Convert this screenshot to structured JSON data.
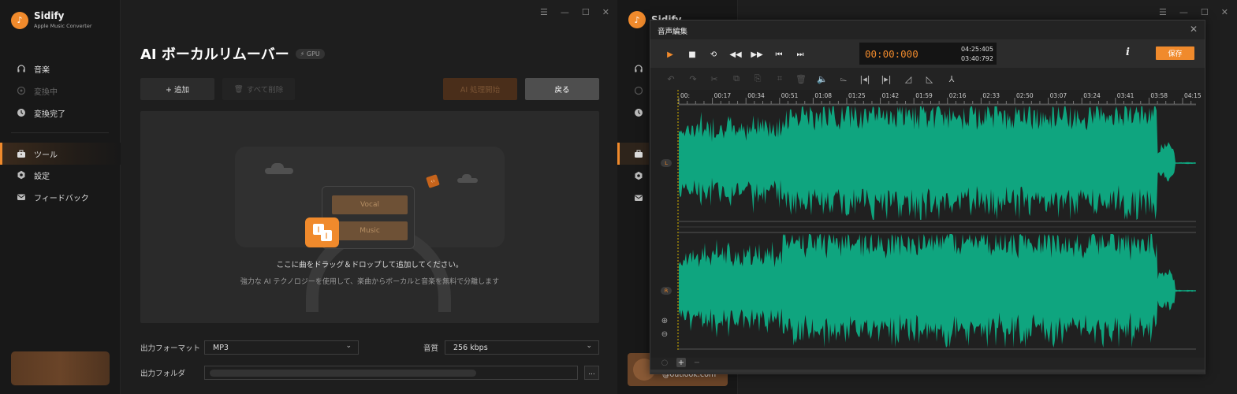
{
  "brand": {
    "name": "Sidify",
    "subtitle": "Apple Music Converter"
  },
  "window_controls": [
    "☰",
    "—",
    "☐",
    "✕"
  ],
  "sidebar": {
    "items": [
      {
        "label": "音楽",
        "icon": "headphones-icon"
      },
      {
        "label": "変換中",
        "icon": "converting-icon"
      },
      {
        "label": "変換完了",
        "icon": "clock-icon"
      },
      {
        "label": "ツール",
        "icon": "toolbox-icon"
      },
      {
        "label": "設定",
        "icon": "gear-icon"
      },
      {
        "label": "フィードバック",
        "icon": "mail-icon"
      }
    ]
  },
  "main": {
    "title": "AI ボーカルリムーバー",
    "gpu_badge": "GPU",
    "add_label": "+ 追加",
    "clear_label": "すべて削除",
    "ai_start_label": "AI 処理開始",
    "back_label": "戻る",
    "drop_pill_vocal": "Vocal",
    "drop_pill_music": "Music",
    "drop_text": "ここに曲をドラッグ＆ドロップして追加してください。",
    "drop_subtext": "強力な AI テクノロジーを使用して、楽曲からボーカルと音楽を無料で分離します",
    "output_format_label": "出力フォーマット",
    "output_format_value": "MP3",
    "quality_label": "音質",
    "quality_value": "256 kbps",
    "output_folder_label": "出力フォルダ",
    "folder_button": "..."
  },
  "right_window": {
    "brand_name": "Sidify",
    "account_text": "@outlook.com"
  },
  "editor": {
    "title": "音声編集",
    "current_time": "00:00:000",
    "total_time": "04:25:405",
    "selection_time": "03:40:792",
    "info_label": "i",
    "save_label": "保存",
    "channel_left": "L",
    "channel_right": "R",
    "timeline_ticks": [
      "00:",
      "00:17",
      "00:34",
      "00:51",
      "01:08",
      "01:25",
      "01:42",
      "01:59",
      "02:16",
      "02:33",
      "02:50",
      "03:07",
      "03:24",
      "03:41",
      "03:58",
      "04:15"
    ],
    "waveform_color": "#0fa57f"
  },
  "colors": {
    "accent": "#f08a2c",
    "waveform": "#0fa57f"
  }
}
